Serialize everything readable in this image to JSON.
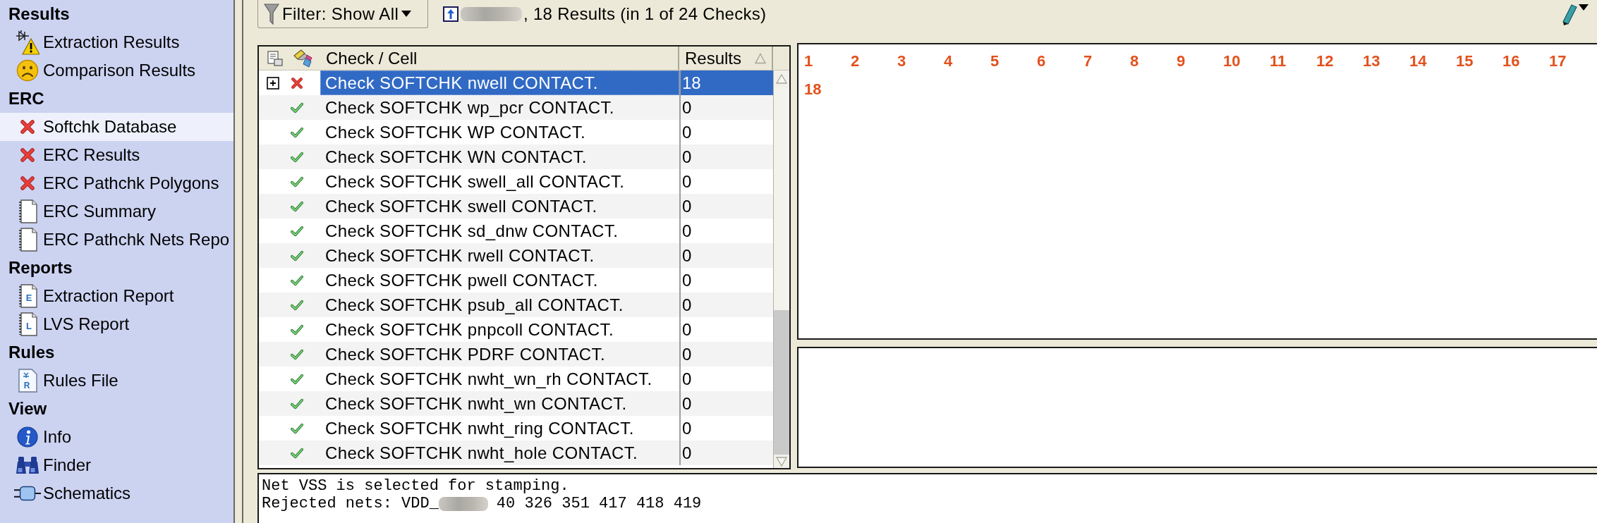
{
  "sidebar": {
    "sections": [
      {
        "title": "Results",
        "items": [
          {
            "label": "Extraction Results",
            "kind": "netlist-warning",
            "selected": false
          },
          {
            "label": "Comparison Results",
            "kind": "sad",
            "selected": false
          }
        ]
      },
      {
        "title": "ERC",
        "items": [
          {
            "label": "Softchk Database",
            "kind": "fail",
            "selected": true
          },
          {
            "label": "ERC Results",
            "kind": "fail",
            "selected": false
          },
          {
            "label": "ERC Pathchk Polygons",
            "kind": "fail",
            "selected": false
          },
          {
            "label": "ERC Summary",
            "kind": "document",
            "selected": false
          },
          {
            "label": "ERC Pathchk Nets Repo",
            "kind": "document",
            "selected": false
          }
        ]
      },
      {
        "title": "Reports",
        "items": [
          {
            "label": "Extraction Report",
            "kind": "document",
            "letter": "E",
            "selected": false
          },
          {
            "label": "LVS Report",
            "kind": "document",
            "letter": "L",
            "selected": false
          }
        ]
      },
      {
        "title": "Rules",
        "items": [
          {
            "label": "Rules File",
            "kind": "rules",
            "letter": "R",
            "selected": false
          }
        ]
      },
      {
        "title": "View",
        "items": [
          {
            "label": "Info",
            "kind": "info",
            "selected": false
          },
          {
            "label": "Finder",
            "kind": "binoculars",
            "selected": false
          },
          {
            "label": "Schematics",
            "kind": "plug",
            "selected": false
          }
        ]
      }
    ]
  },
  "toolbar": {
    "filter_button": "Filter: Show All",
    "summary": ", 18 Results (in 1 of 24 Checks)",
    "summary_redacted": true
  },
  "table": {
    "columns": [
      {
        "label": "Check / Cell",
        "sorted": false
      },
      {
        "label": "Results",
        "sorted": true
      }
    ],
    "rows": [
      {
        "check": "Check SOFTCHK nwell CONTACT.",
        "results": "18",
        "kind": "fail",
        "expandable": true,
        "selected": true
      },
      {
        "check": "Check SOFTCHK wp_pcr CONTACT.",
        "results": "0",
        "kind": "pass",
        "expandable": false,
        "selected": false
      },
      {
        "check": "Check SOFTCHK WP CONTACT.",
        "results": "0",
        "kind": "pass",
        "expandable": false,
        "selected": false
      },
      {
        "check": "Check SOFTCHK WN CONTACT.",
        "results": "0",
        "kind": "pass",
        "expandable": false,
        "selected": false
      },
      {
        "check": "Check SOFTCHK swell_all CONTACT.",
        "results": "0",
        "kind": "pass",
        "expandable": false,
        "selected": false
      },
      {
        "check": "Check SOFTCHK swell CONTACT.",
        "results": "0",
        "kind": "pass",
        "expandable": false,
        "selected": false
      },
      {
        "check": "Check SOFTCHK sd_dnw CONTACT.",
        "results": "0",
        "kind": "pass",
        "expandable": false,
        "selected": false
      },
      {
        "check": "Check SOFTCHK rwell CONTACT.",
        "results": "0",
        "kind": "pass",
        "expandable": false,
        "selected": false
      },
      {
        "check": "Check SOFTCHK pwell CONTACT.",
        "results": "0",
        "kind": "pass",
        "expandable": false,
        "selected": false
      },
      {
        "check": "Check SOFTCHK psub_all CONTACT.",
        "results": "0",
        "kind": "pass",
        "expandable": false,
        "selected": false
      },
      {
        "check": "Check SOFTCHK pnpcoll CONTACT.",
        "results": "0",
        "kind": "pass",
        "expandable": false,
        "selected": false
      },
      {
        "check": "Check SOFTCHK PDRF CONTACT.",
        "results": "0",
        "kind": "pass",
        "expandable": false,
        "selected": false
      },
      {
        "check": "Check SOFTCHK nwht_wn_rh CONTACT.",
        "results": "0",
        "kind": "pass",
        "expandable": false,
        "selected": false
      },
      {
        "check": "Check SOFTCHK nwht_wn CONTACT.",
        "results": "0",
        "kind": "pass",
        "expandable": false,
        "selected": false
      },
      {
        "check": "Check SOFTCHK nwht_ring CONTACT.",
        "results": "0",
        "kind": "pass",
        "expandable": false,
        "selected": false
      },
      {
        "check": "Check SOFTCHK nwht_hole CONTACT.",
        "results": "0",
        "kind": "pass",
        "expandable": false,
        "selected": false
      }
    ]
  },
  "results_view": {
    "numbers": [
      "1",
      "2",
      "3",
      "4",
      "5",
      "6",
      "7",
      "8",
      "9",
      "10",
      "11",
      "12",
      "13",
      "14",
      "15",
      "16",
      "17",
      "18"
    ]
  },
  "log": {
    "lines": [
      {
        "text": "Net VSS is selected for stamping.",
        "redacted": false
      },
      {
        "text": "Rejected nets: VDD_",
        "redacted": true,
        "after": "40 326 351 417 418 419"
      }
    ]
  }
}
